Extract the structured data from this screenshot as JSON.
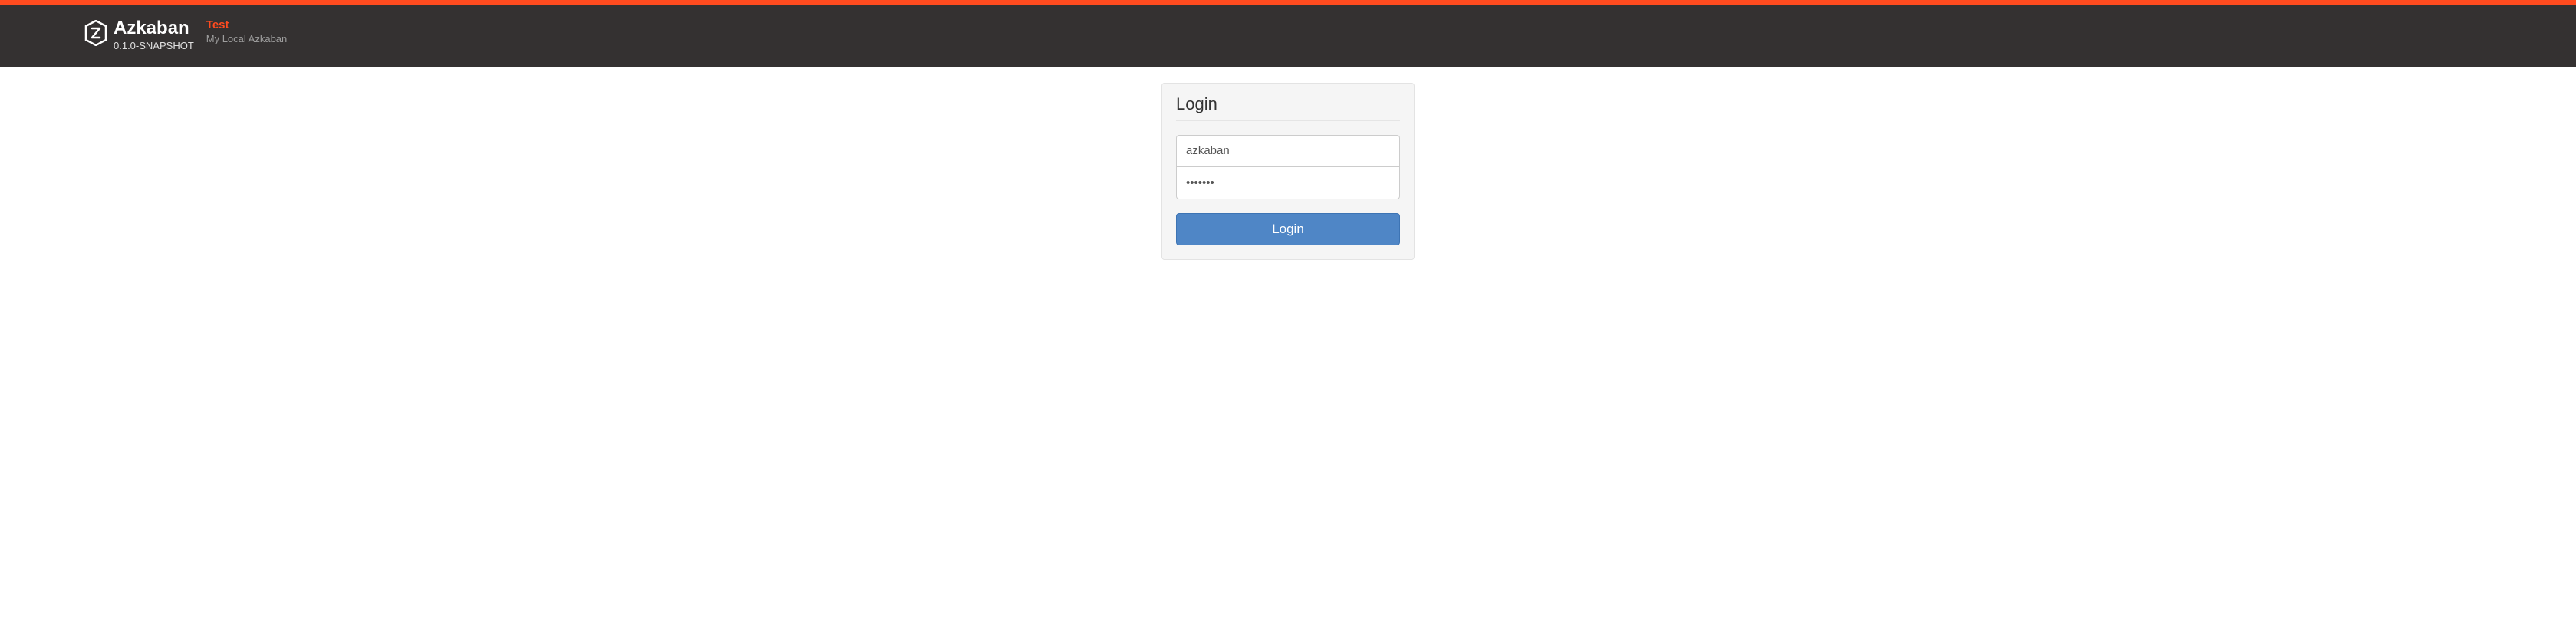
{
  "header": {
    "app_name": "Azkaban",
    "version": "0.1.0-SNAPSHOT",
    "env_name": "Test",
    "env_desc": "My Local Azkaban"
  },
  "login": {
    "title": "Login",
    "username_value": "azkaban",
    "password_value": "•••••••",
    "button_label": "Login"
  }
}
